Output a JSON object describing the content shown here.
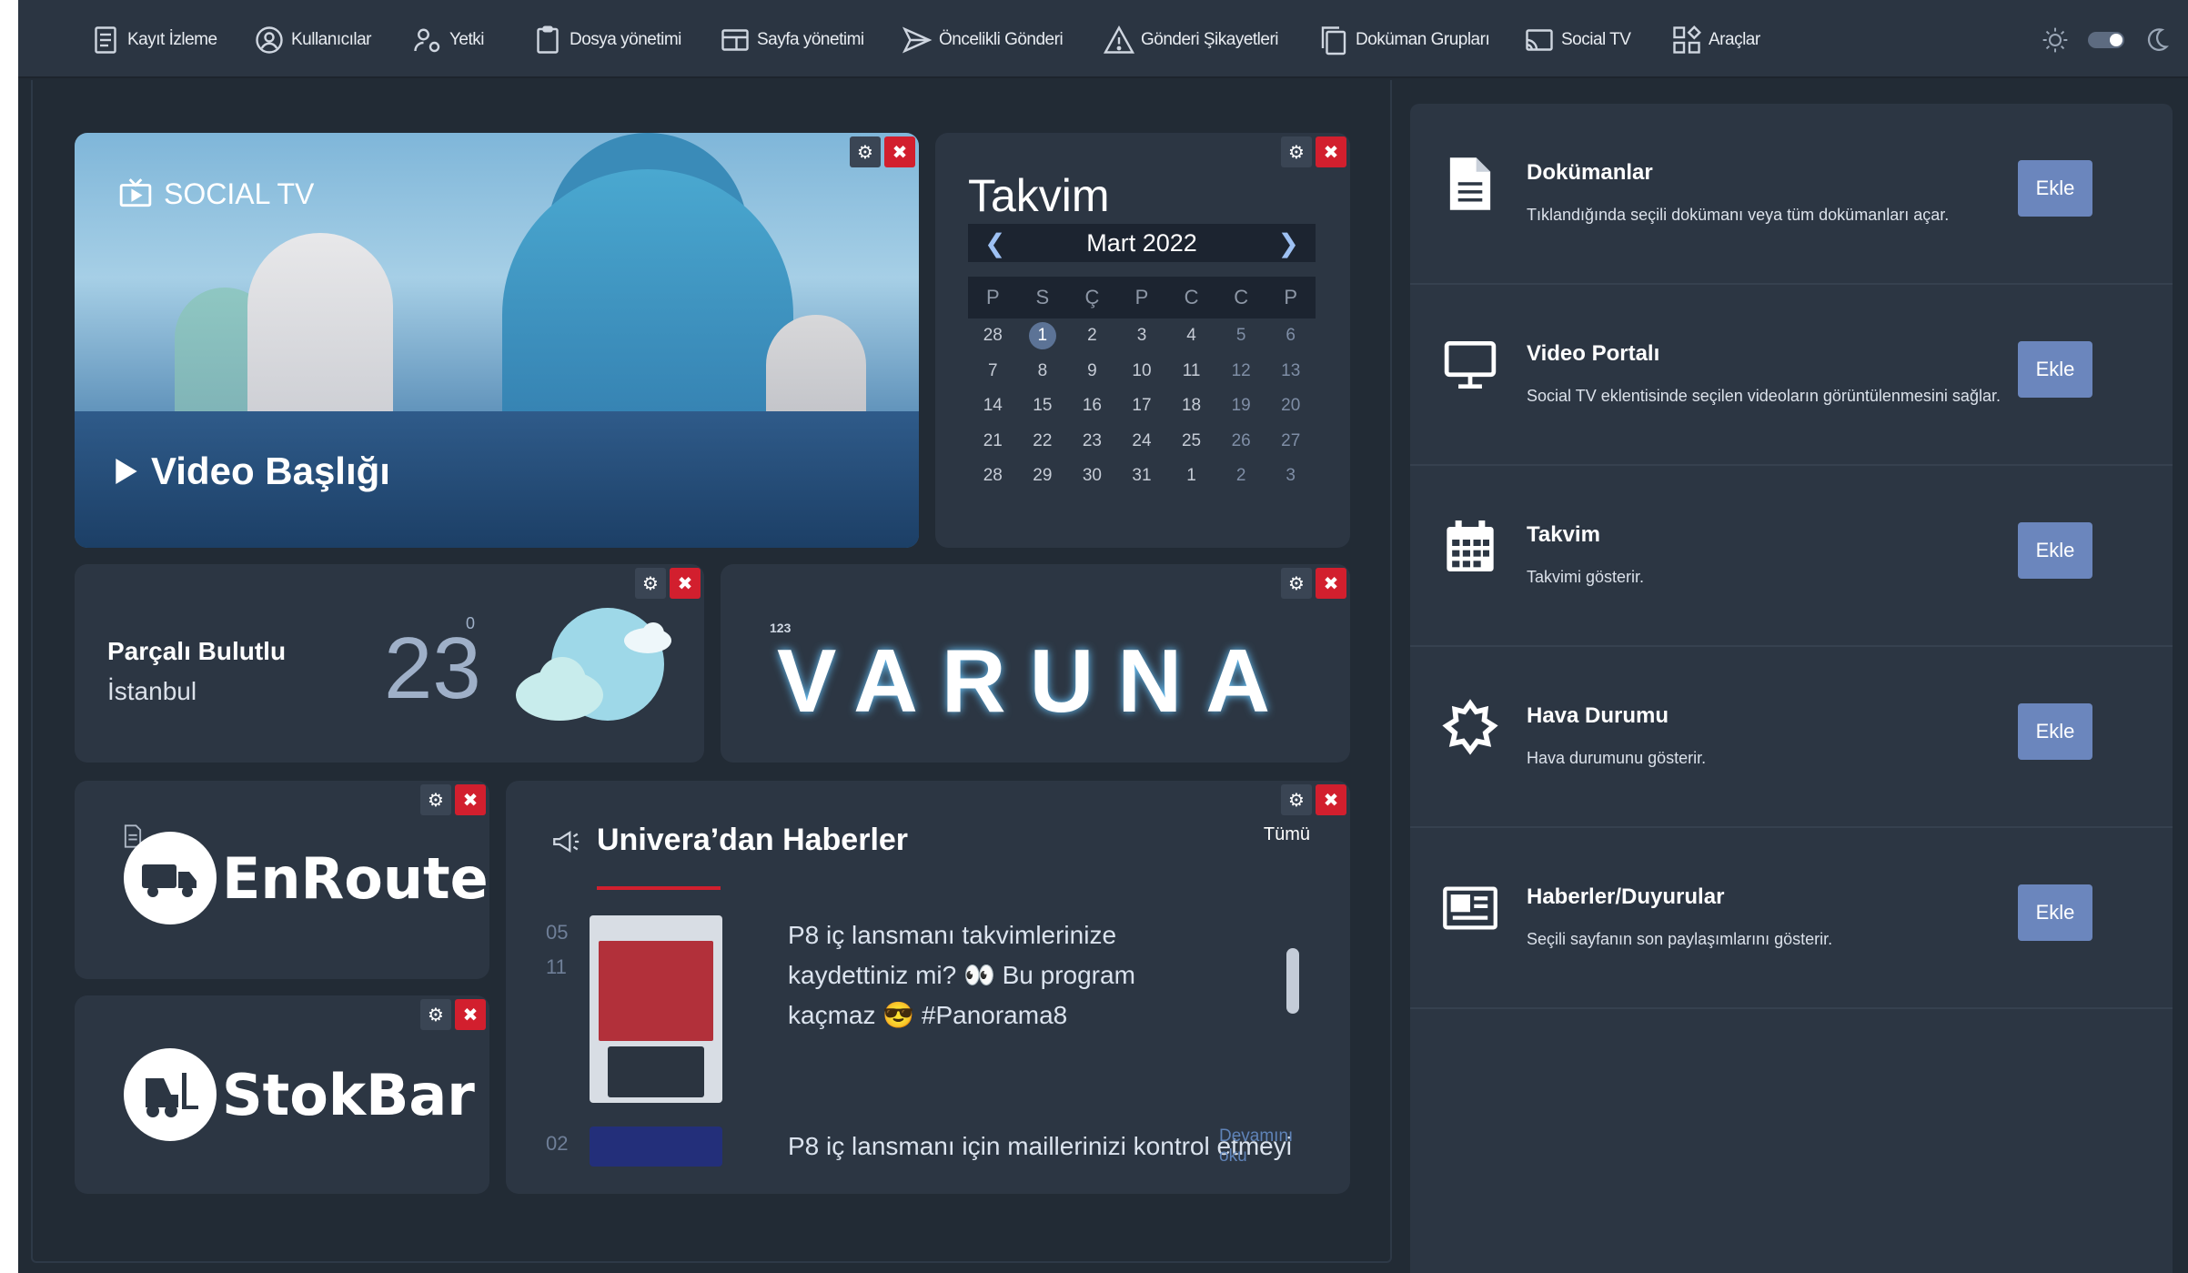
{
  "nav": {
    "items": [
      {
        "label": "Kayıt İzleme",
        "icon": "list-icon"
      },
      {
        "label": "Kullanıcılar",
        "icon": "user-circle-icon"
      },
      {
        "label": "Yetki",
        "icon": "user-gear-icon"
      },
      {
        "label": "Dosya yönetimi",
        "icon": "clipboard-icon"
      },
      {
        "label": "Sayfa yönetimi",
        "icon": "page-layout-icon"
      },
      {
        "label": "Öncelikli Gönderi",
        "icon": "send-icon"
      },
      {
        "label": "Gönderi Şikayetleri",
        "icon": "warning-icon"
      },
      {
        "label": "Doküman Grupları",
        "icon": "documents-icon"
      },
      {
        "label": "Social TV",
        "icon": "cast-icon"
      },
      {
        "label": "Araçlar",
        "icon": "tools-grid-icon"
      }
    ]
  },
  "video": {
    "channel": "SOCIAL TV",
    "title": "Video Başlığı"
  },
  "calendar": {
    "title": "Takvim",
    "month": "Mart 2022",
    "weekdays": [
      "P",
      "S",
      "Ç",
      "P",
      "C",
      "C",
      "P"
    ],
    "weeks": [
      [
        "28",
        "1",
        "2",
        "3",
        "4",
        "5",
        "6"
      ],
      [
        "7",
        "8",
        "9",
        "10",
        "11",
        "12",
        "13"
      ],
      [
        "14",
        "15",
        "16",
        "17",
        "18",
        "19",
        "20"
      ],
      [
        "21",
        "22",
        "23",
        "24",
        "25",
        "26",
        "27"
      ],
      [
        "28",
        "29",
        "30",
        "31",
        "1",
        "2",
        "3"
      ]
    ],
    "today": "1"
  },
  "weather": {
    "condition": "Parçalı Bulutlu",
    "city": "İstanbul",
    "temperature": "23",
    "unit": "0"
  },
  "varuna": {
    "sup": "123",
    "name": "VARUNA"
  },
  "enroute": {
    "name": "EnRoute"
  },
  "stokbar": {
    "name": "StokBar"
  },
  "news": {
    "title": "Univera’dan Haberler",
    "all_link": "Tümü",
    "items": [
      {
        "day": "05",
        "month": "11",
        "text": "P8 iç lansmanı takvimlerinize kaydettiniz mi? 👀 Bu program kaçmaz 😎 #Panorama8"
      },
      {
        "day": "02",
        "text": "P8 iç lansmanı için maillerinizi kontrol etmeyi",
        "more": "Devamını oku"
      }
    ]
  },
  "widgets": [
    {
      "title": "Dokümanlar",
      "desc": "Tıklandığında seçili dokümanı veya tüm dokümanları açar.",
      "button": "Ekle",
      "icon": "document-icon"
    },
    {
      "title": "Video Portalı",
      "desc": "Social TV eklentisinde seçilen videoların görüntülenmesini sağlar.",
      "button": "Ekle",
      "icon": "monitor-icon"
    },
    {
      "title": "Takvim",
      "desc": "Takvimi gösterir.",
      "button": "Ekle",
      "icon": "calendar-icon"
    },
    {
      "title": "Hava Durumu",
      "desc": "Hava durumunu gösterir.",
      "button": "Ekle",
      "icon": "sun-icon"
    },
    {
      "title": "Haberler/Duyurular",
      "desc": "Seçili sayfanın son paylaşımlarını gösterir.",
      "button": "Ekle",
      "icon": "newspaper-icon"
    }
  ]
}
